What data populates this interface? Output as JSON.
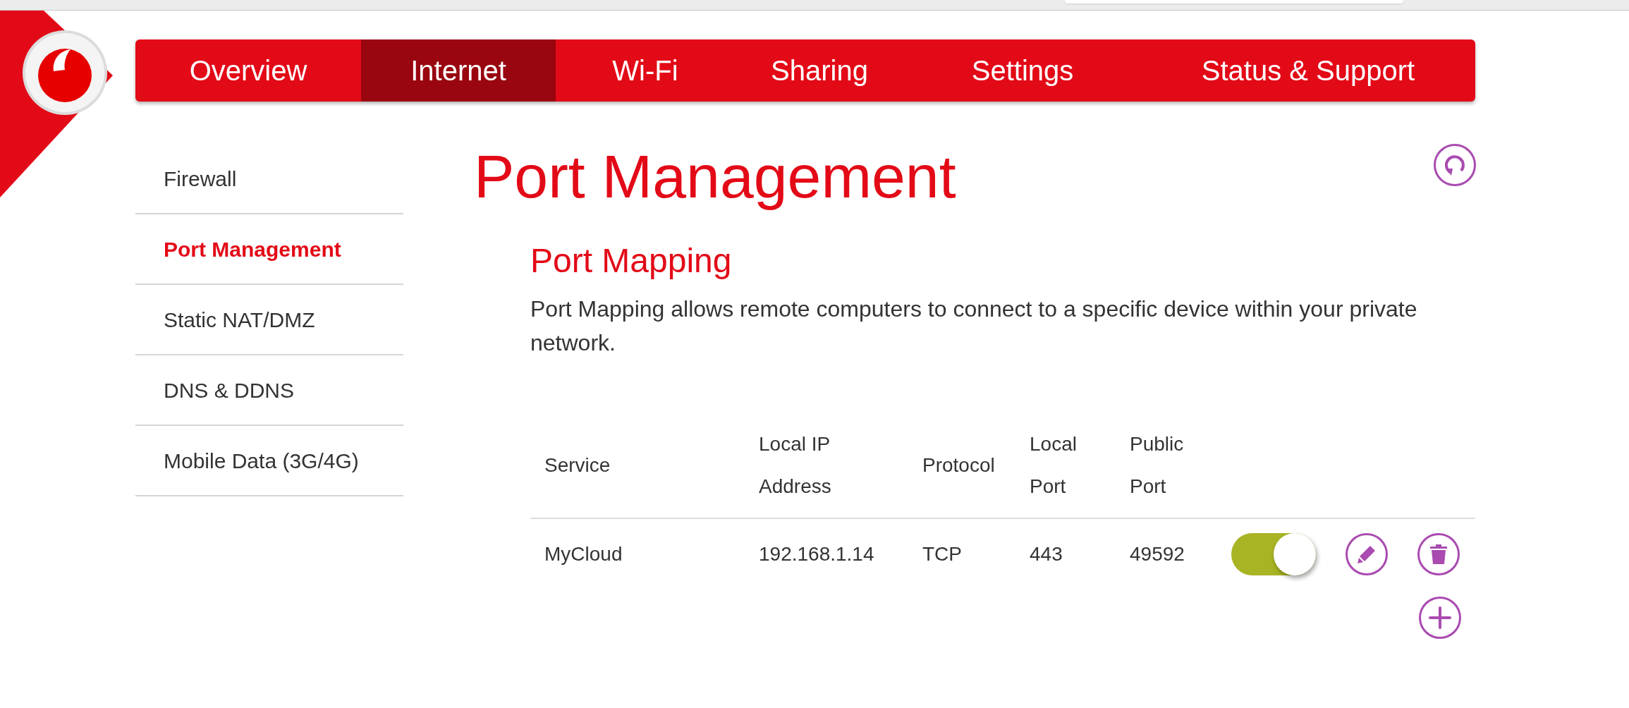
{
  "nav": [
    {
      "label": "Overview",
      "selected": false
    },
    {
      "label": "Internet",
      "selected": true
    },
    {
      "label": "Wi-Fi",
      "selected": false
    },
    {
      "label": "Sharing",
      "selected": false
    },
    {
      "label": "Settings",
      "selected": false
    },
    {
      "label": "Status & Support",
      "selected": false
    }
  ],
  "sidebar": {
    "items": [
      {
        "label": "Firewall",
        "selected": false
      },
      {
        "label": "Port Management",
        "selected": true
      },
      {
        "label": "Static NAT/DMZ",
        "selected": false
      },
      {
        "label": "DNS & DDNS",
        "selected": false
      },
      {
        "label": "Mobile Data (3G/4G)",
        "selected": false
      }
    ]
  },
  "page_title": "Port Management",
  "section": {
    "title": "Port Mapping",
    "description": "Port Mapping allows remote computers to connect to a specific device within your private network.",
    "table": {
      "columns": [
        "Service",
        "Local IP Address",
        "Protocol",
        "Local Port",
        "Public Port"
      ],
      "rows": [
        {
          "cells": [
            "MyCloud",
            "192.168.1.14",
            "TCP",
            "443",
            "49592"
          ],
          "enabled": true
        }
      ]
    }
  }
}
